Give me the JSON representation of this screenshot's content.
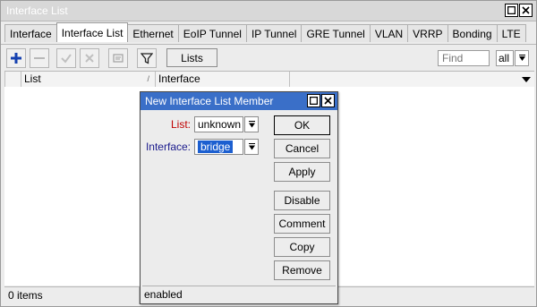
{
  "window": {
    "title": "Interface List"
  },
  "tabs": [
    {
      "label": "Interface",
      "active": false
    },
    {
      "label": "Interface List",
      "active": true
    },
    {
      "label": "Ethernet",
      "active": false
    },
    {
      "label": "EoIP Tunnel",
      "active": false
    },
    {
      "label": "IP Tunnel",
      "active": false
    },
    {
      "label": "GRE Tunnel",
      "active": false
    },
    {
      "label": "VLAN",
      "active": false
    },
    {
      "label": "VRRP",
      "active": false
    },
    {
      "label": "Bonding",
      "active": false
    },
    {
      "label": "LTE",
      "active": false
    }
  ],
  "toolbar": {
    "lists_label": "Lists",
    "find_placeholder": "Find",
    "filter_value": "all"
  },
  "table": {
    "columns": [
      "List",
      "Interface"
    ],
    "sort_marker": "/"
  },
  "status": {
    "items": "0 items"
  },
  "dialog": {
    "title": "New Interface List Member",
    "list_label": "List:",
    "list_value": "unknown",
    "interface_label": "Interface:",
    "interface_value": "bridge",
    "buttons": {
      "ok": "OK",
      "cancel": "Cancel",
      "apply": "Apply",
      "disable": "Disable",
      "comment": "Comment",
      "copy": "Copy",
      "remove": "Remove"
    },
    "status": "enabled"
  },
  "colors": {
    "dialog_title_bg": "#3a6fc8",
    "list_label": "#c00000",
    "interface_label": "#1a1a8c",
    "add_icon": "#1540b0"
  }
}
